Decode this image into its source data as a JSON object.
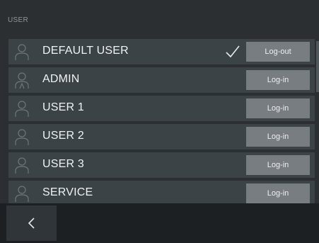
{
  "header": {
    "title": "USER"
  },
  "users": [
    {
      "name": "DEFAULT USER",
      "button": "Log-out",
      "active": true
    },
    {
      "name": "ADMIN",
      "button": "Log-in",
      "active": false
    },
    {
      "name": "USER 1",
      "button": "Log-in",
      "active": false
    },
    {
      "name": "USER 2",
      "button": "Log-in",
      "active": false
    },
    {
      "name": "USER 3",
      "button": "Log-in",
      "active": false
    },
    {
      "name": "SERVICE",
      "button": "Log-in",
      "active": false
    }
  ],
  "icons": {
    "avatar": "user-icon",
    "active": "checkmark-icon",
    "back": "chevron-left-icon"
  },
  "colors": {
    "background": "#2b2f31",
    "row": "#3b4346",
    "button": "#777d80",
    "footer": "#1c2022"
  }
}
